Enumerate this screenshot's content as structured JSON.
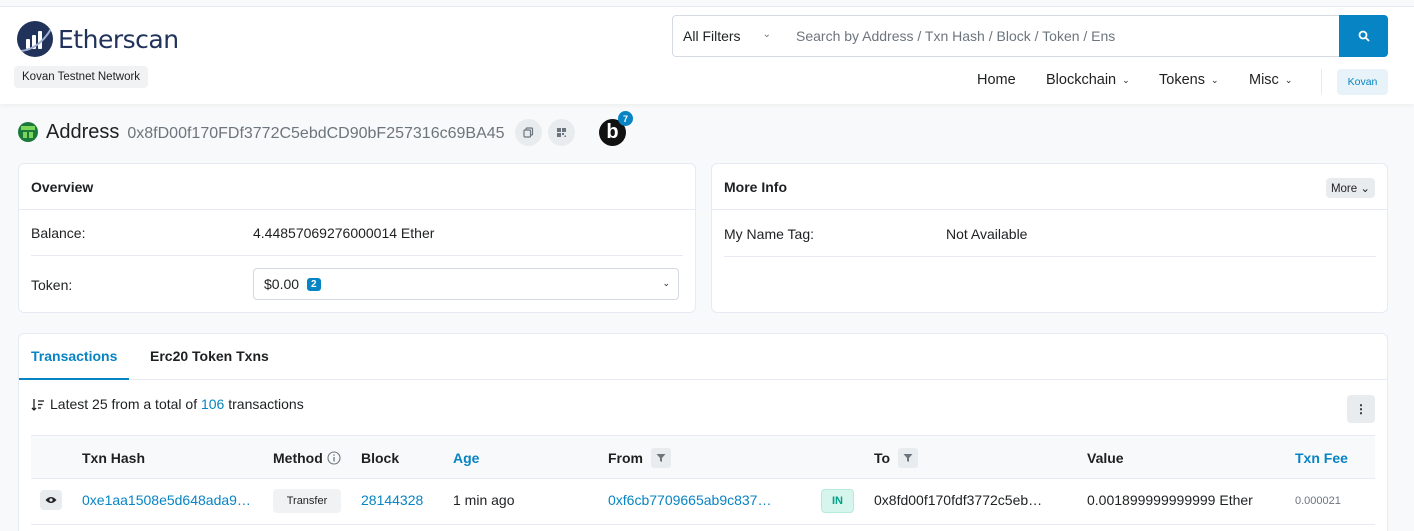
{
  "brand": {
    "name": "Etherscan",
    "network_badge": "Kovan Testnet Network"
  },
  "search": {
    "filter_label": "All Filters",
    "placeholder": "Search by Address / Txn Hash / Block / Token / Ens"
  },
  "nav": {
    "home": "Home",
    "blockchain": "Blockchain",
    "tokens": "Tokens",
    "misc": "Misc",
    "network_button": "Kovan"
  },
  "address": {
    "title": "Address",
    "hash": "0x8fD00f170FDf3772C5ebdCD90bF257316c69BA45",
    "b_logo": "b",
    "b_badge": "7"
  },
  "overview": {
    "title": "Overview",
    "balance_label": "Balance:",
    "balance_value": "4.44857069276000014 Ether",
    "token_label": "Token:",
    "token_value": "$0.00",
    "token_count": "2"
  },
  "more_info": {
    "title": "More Info",
    "more_button": "More",
    "name_tag_label": "My Name Tag:",
    "name_tag_value": "Not Available"
  },
  "tabs": {
    "transactions": "Transactions",
    "erc20": "Erc20 Token Txns"
  },
  "summary": {
    "prefix": "Latest 25 from a total of",
    "total": "106",
    "suffix": "transactions"
  },
  "table": {
    "headers": {
      "txn_hash": "Txn Hash",
      "method": "Method",
      "block": "Block",
      "age": "Age",
      "from": "From",
      "to": "To",
      "value": "Value",
      "txn_fee": "Txn Fee"
    },
    "rows": [
      {
        "txn_hash": "0xe1aa1508e5d648ada9…",
        "method": "Transfer",
        "block": "28144328",
        "age": "1 min ago",
        "from": "0xf6cb7709665ab9c837…",
        "direction": "IN",
        "to": "0x8fd00f170fdf3772c5eb…",
        "value": "0.001899999999999 Ether",
        "txn_fee": "0.000021"
      }
    ]
  },
  "colors": {
    "brand_blue": "#0784c3",
    "logo_navy": "#21325b",
    "in_green": "#00a186"
  },
  "icons": [
    "etherscan-logo-icon",
    "chevron-down-icon",
    "search-icon",
    "copy-icon",
    "qr-code-icon",
    "sort-icon",
    "more-vertical-icon",
    "info-icon",
    "filter-icon",
    "eye-icon"
  ]
}
